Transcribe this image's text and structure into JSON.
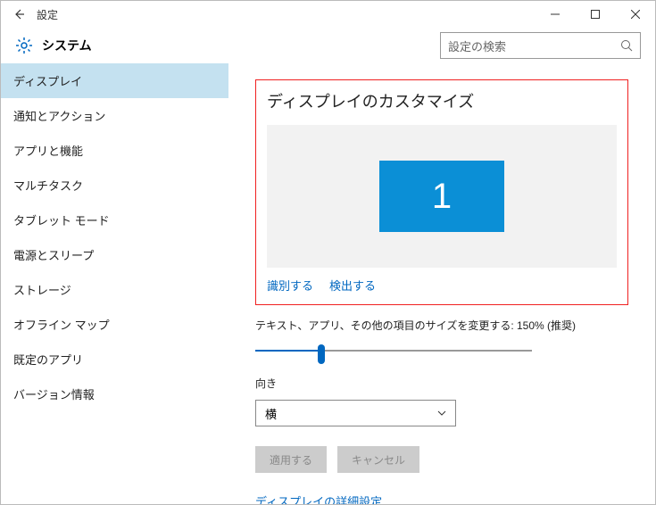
{
  "window": {
    "title": "設定"
  },
  "header": {
    "title": "システム",
    "search_placeholder": "設定の検索"
  },
  "sidebar": {
    "items": [
      {
        "label": "ディスプレイ",
        "selected": true
      },
      {
        "label": "通知とアクション"
      },
      {
        "label": "アプリと機能"
      },
      {
        "label": "マルチタスク"
      },
      {
        "label": "タブレット モード"
      },
      {
        "label": "電源とスリープ"
      },
      {
        "label": "ストレージ"
      },
      {
        "label": "オフライン マップ"
      },
      {
        "label": "既定のアプリ"
      },
      {
        "label": "バージョン情報"
      }
    ]
  },
  "main": {
    "section_title": "ディスプレイのカスタマイズ",
    "monitor_number": "1",
    "identify": "識別する",
    "detect": "検出する",
    "size_label": "テキスト、アプリ、その他の項目のサイズを変更する: 150% (推奨)",
    "orientation_label": "向き",
    "orientation_value": "横",
    "apply": "適用する",
    "cancel": "キャンセル",
    "advanced": "ディスプレイの詳細設定"
  }
}
